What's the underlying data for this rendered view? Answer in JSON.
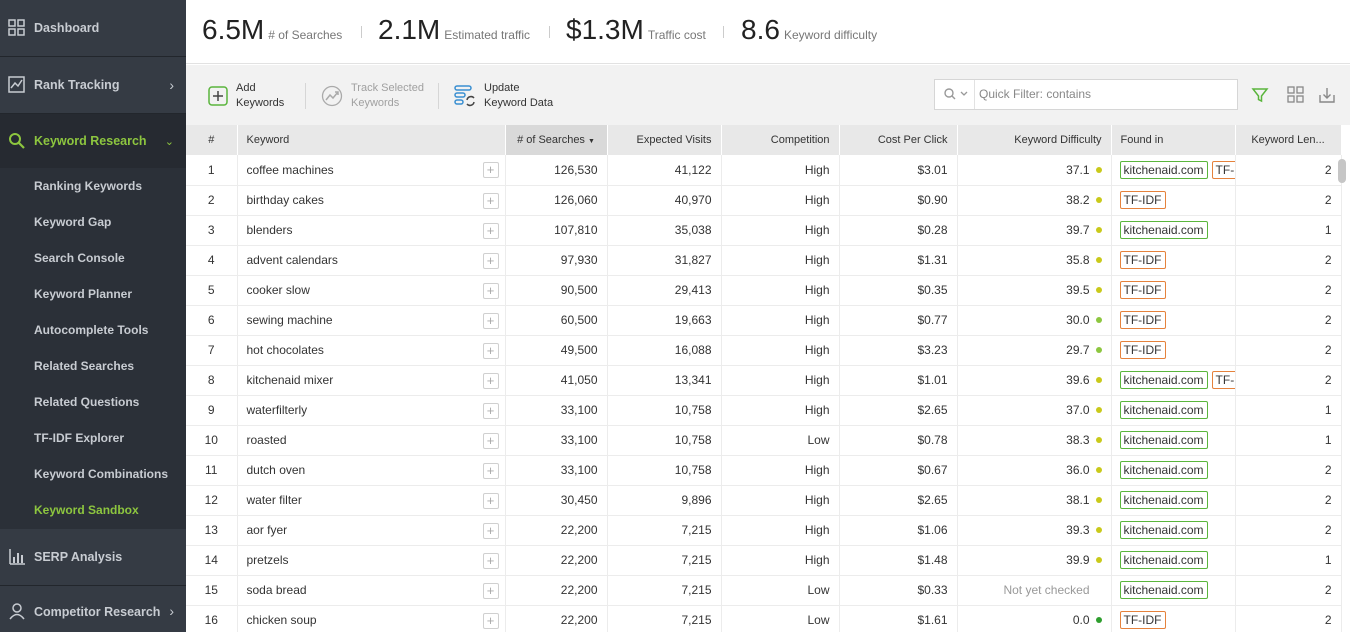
{
  "sidebar": {
    "dashboard": "Dashboard",
    "rank_tracking": "Rank Tracking",
    "keyword_research": "Keyword Research",
    "sub_items": [
      "Ranking Keywords",
      "Keyword Gap",
      "Search Console",
      "Keyword Planner",
      "Autocomplete Tools",
      "Related Searches",
      "Related Questions",
      "TF-IDF Explorer",
      "Keyword Combinations",
      "Keyword Sandbox"
    ],
    "active_sub": "Keyword Sandbox",
    "serp_analysis": "SERP Analysis",
    "competitor_research": "Competitor Research",
    "accent_color": "#8dc63f"
  },
  "stats": [
    {
      "value": "6.5M",
      "label": "# of Searches"
    },
    {
      "value": "2.1M",
      "label": "Estimated traffic"
    },
    {
      "value": "$1.3M",
      "label": "Traffic cost"
    },
    {
      "value": "8.6",
      "label": "Keyword difficulty"
    }
  ],
  "toolbar": {
    "add_line1": "Add",
    "add_line2": "Keywords",
    "track_line1": "Track Selected",
    "track_line2": "Keywords",
    "update_line1": "Update",
    "update_line2": "Keyword Data",
    "filter_placeholder": "Quick Filter: contains"
  },
  "table": {
    "headers": {
      "num": "#",
      "keyword": "Keyword",
      "searches": "# of Searches",
      "visits": "Expected Visits",
      "competition": "Competition",
      "cpc": "Cost Per Click",
      "difficulty": "Keyword Difficulty",
      "found": "Found in",
      "length": "Keyword Len..."
    },
    "dot_colors": {
      "yellow": "#c9c91a",
      "green": "#8dc63f",
      "darkgreen": "#2e9e2e"
    },
    "rows": [
      {
        "n": "1",
        "kw": "coffee machines",
        "s": "126,530",
        "v": "41,122",
        "c": "High",
        "cpc": "$3.01",
        "d": "37.1",
        "dot": "yellow",
        "found": [
          "kitchenaid.com",
          "TF-IDF"
        ],
        "len": "2"
      },
      {
        "n": "2",
        "kw": "birthday cakes",
        "s": "126,060",
        "v": "40,970",
        "c": "High",
        "cpc": "$0.90",
        "d": "38.2",
        "dot": "yellow",
        "found": [
          "TF-IDF"
        ],
        "len": "2"
      },
      {
        "n": "3",
        "kw": "blenders",
        "s": "107,810",
        "v": "35,038",
        "c": "High",
        "cpc": "$0.28",
        "d": "39.7",
        "dot": "yellow",
        "found": [
          "kitchenaid.com"
        ],
        "len": "1"
      },
      {
        "n": "4",
        "kw": "advent calendars",
        "s": "97,930",
        "v": "31,827",
        "c": "High",
        "cpc": "$1.31",
        "d": "35.8",
        "dot": "yellow",
        "found": [
          "TF-IDF"
        ],
        "len": "2"
      },
      {
        "n": "5",
        "kw": "cooker slow",
        "s": "90,500",
        "v": "29,413",
        "c": "High",
        "cpc": "$0.35",
        "d": "39.5",
        "dot": "yellow",
        "found": [
          "TF-IDF"
        ],
        "len": "2"
      },
      {
        "n": "6",
        "kw": "sewing machine",
        "s": "60,500",
        "v": "19,663",
        "c": "High",
        "cpc": "$0.77",
        "d": "30.0",
        "dot": "green",
        "found": [
          "TF-IDF"
        ],
        "len": "2"
      },
      {
        "n": "7",
        "kw": "hot chocolates",
        "s": "49,500",
        "v": "16,088",
        "c": "High",
        "cpc": "$3.23",
        "d": "29.7",
        "dot": "green",
        "found": [
          "TF-IDF"
        ],
        "len": "2"
      },
      {
        "n": "8",
        "kw": "kitchenaid mixer",
        "s": "41,050",
        "v": "13,341",
        "c": "High",
        "cpc": "$1.01",
        "d": "39.6",
        "dot": "yellow",
        "found": [
          "kitchenaid.com",
          "TF-IDF"
        ],
        "len": "2"
      },
      {
        "n": "9",
        "kw": "waterfilterly",
        "s": "33,100",
        "v": "10,758",
        "c": "High",
        "cpc": "$2.65",
        "d": "37.0",
        "dot": "yellow",
        "found": [
          "kitchenaid.com"
        ],
        "len": "1"
      },
      {
        "n": "10",
        "kw": "roasted",
        "s": "33,100",
        "v": "10,758",
        "c": "Low",
        "cpc": "$0.78",
        "d": "38.3",
        "dot": "yellow",
        "found": [
          "kitchenaid.com"
        ],
        "len": "1"
      },
      {
        "n": "11",
        "kw": "dutch oven",
        "s": "33,100",
        "v": "10,758",
        "c": "High",
        "cpc": "$0.67",
        "d": "36.0",
        "dot": "yellow",
        "found": [
          "kitchenaid.com"
        ],
        "len": "2"
      },
      {
        "n": "12",
        "kw": "water filter",
        "s": "30,450",
        "v": "9,896",
        "c": "High",
        "cpc": "$2.65",
        "d": "38.1",
        "dot": "yellow",
        "found": [
          "kitchenaid.com"
        ],
        "len": "2"
      },
      {
        "n": "13",
        "kw": "aor fyer",
        "s": "22,200",
        "v": "7,215",
        "c": "High",
        "cpc": "$1.06",
        "d": "39.3",
        "dot": "yellow",
        "found": [
          "kitchenaid.com"
        ],
        "len": "2"
      },
      {
        "n": "14",
        "kw": "pretzels",
        "s": "22,200",
        "v": "7,215",
        "c": "High",
        "cpc": "$1.48",
        "d": "39.9",
        "dot": "yellow",
        "found": [
          "kitchenaid.com"
        ],
        "len": "1"
      },
      {
        "n": "15",
        "kw": "soda bread",
        "s": "22,200",
        "v": "7,215",
        "c": "Low",
        "cpc": "$0.33",
        "d": "Not yet checked",
        "dot": "",
        "found": [
          "kitchenaid.com"
        ],
        "len": "2"
      },
      {
        "n": "16",
        "kw": "chicken soup",
        "s": "22,200",
        "v": "7,215",
        "c": "Low",
        "cpc": "$1.61",
        "d": "0.0",
        "dot": "darkgreen",
        "found": [
          "TF-IDF"
        ],
        "len": "2"
      }
    ]
  }
}
